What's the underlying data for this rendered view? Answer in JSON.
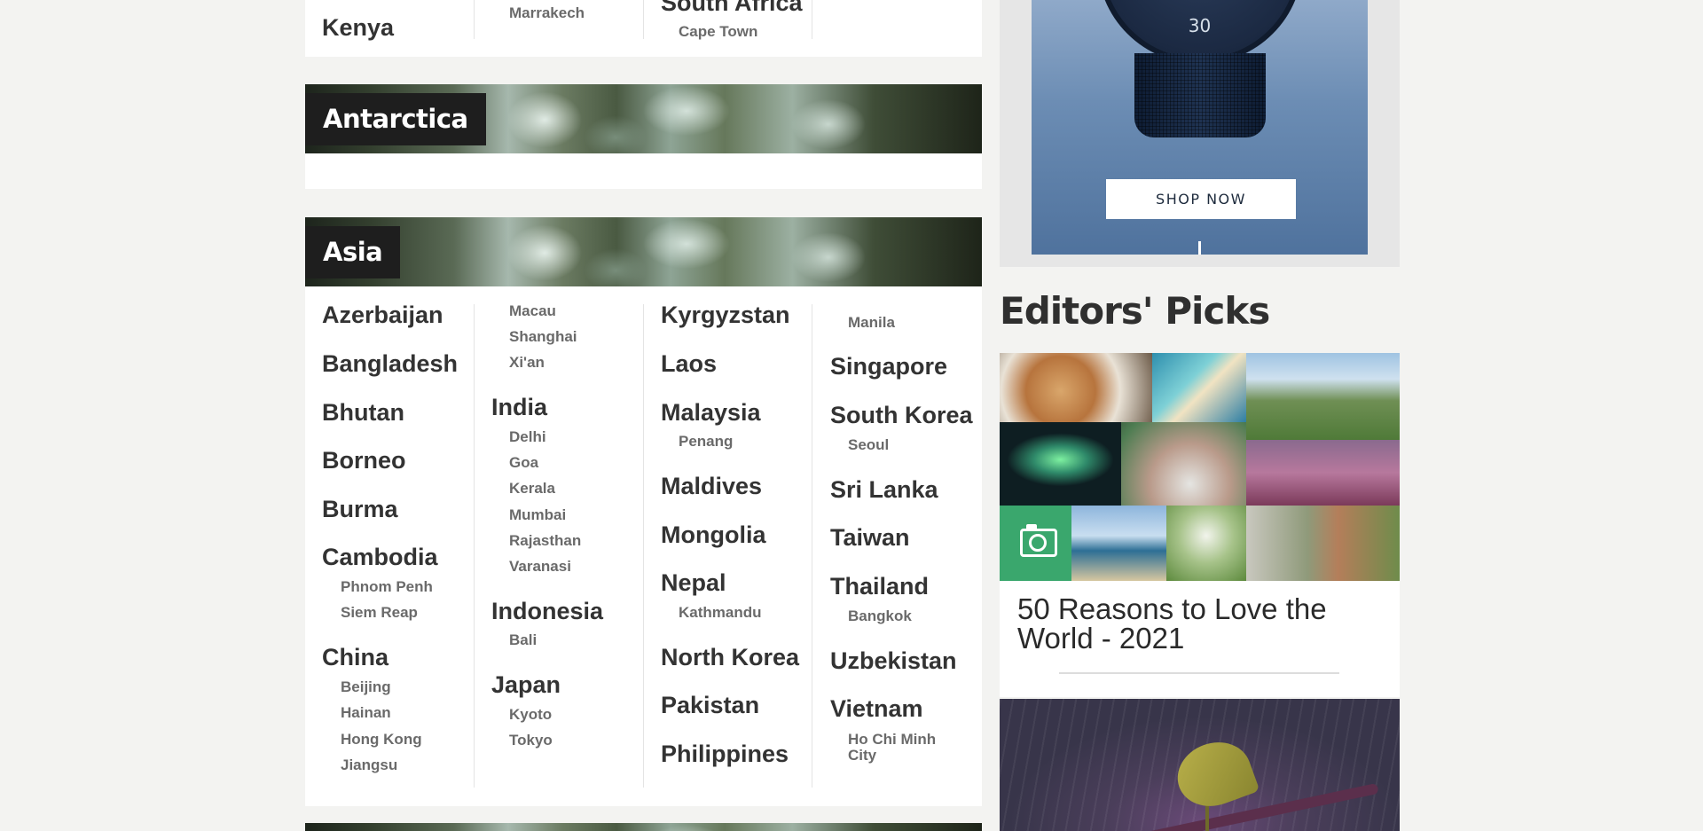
{
  "africa_tail": {
    "country_kenya": "Kenya",
    "city_marrakech": "Marrakech",
    "country_south_africa": "South Africa",
    "city_cape_town": "Cape Town"
  },
  "antarctica": {
    "title": "Antarctica"
  },
  "asia": {
    "title": "Asia",
    "col1": {
      "azerbaijan": "Azerbaijan",
      "bangladesh": "Bangladesh",
      "bhutan": "Bhutan",
      "borneo": "Borneo",
      "burma": "Burma",
      "cambodia": "Cambodia",
      "phnom_penh": "Phnom Penh",
      "siem_reap": "Siem Reap",
      "china": "China",
      "beijing": "Beijing",
      "hainan": "Hainan",
      "hong_kong": "Hong Kong",
      "jiangsu": "Jiangsu"
    },
    "col2": {
      "macau": "Macau",
      "shanghai": "Shanghai",
      "xian": "Xi'an",
      "india": "India",
      "delhi": "Delhi",
      "goa": "Goa",
      "kerala": "Kerala",
      "mumbai": "Mumbai",
      "rajasthan": "Rajasthan",
      "varanasi": "Varanasi",
      "indonesia": "Indonesia",
      "bali": "Bali",
      "japan": "Japan",
      "kyoto": "Kyoto",
      "tokyo": "Tokyo"
    },
    "col3": {
      "kyrgyzstan": "Kyrgyzstan",
      "laos": "Laos",
      "malaysia": "Malaysia",
      "penang": "Penang",
      "maldives": "Maldives",
      "mongolia": "Mongolia",
      "nepal": "Nepal",
      "kathmandu": "Kathmandu",
      "north_korea": "North Korea",
      "pakistan": "Pakistan",
      "philippines": "Philippines"
    },
    "col4": {
      "manila": "Manila",
      "singapore": "Singapore",
      "south_korea": "South Korea",
      "seoul": "Seoul",
      "sri_lanka": "Sri Lanka",
      "taiwan": "Taiwan",
      "thailand": "Thailand",
      "bangkok": "Bangkok",
      "uzbekistan": "Uzbekistan",
      "vietnam": "Vietnam",
      "ho_chi_minh_line1": "Ho Chi Minh",
      "ho_chi_minh_line2": "City"
    }
  },
  "ad": {
    "watch_number": "30",
    "cta": "SHOP NOW"
  },
  "editors_picks": {
    "heading": "Editors' Picks",
    "article1_title": "50 Reasons to Love the World - 2021",
    "article1_icon": "camera-icon"
  },
  "colors": {
    "banner_label_bg": "#1e1e1e",
    "camera_badge": "#3aa76d",
    "page_bg": "#f3f3f1"
  }
}
